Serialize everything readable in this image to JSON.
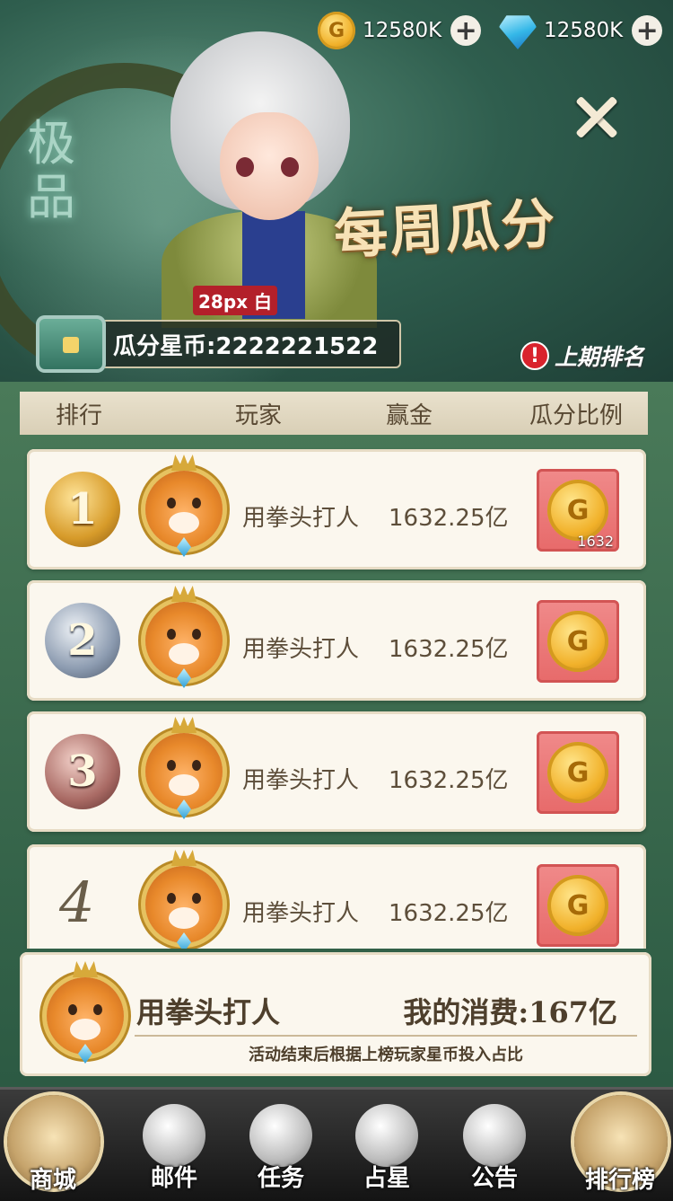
{
  "header": {
    "currencies": [
      {
        "icon": "gold-coin-icon",
        "value": "12580K"
      },
      {
        "icon": "diamond-gem-icon",
        "value": "12580K"
      }
    ],
    "banner_title": "每周瓜分",
    "calligraphy": "极品",
    "size_tip": "28px 白",
    "pool_label": "瓜分星币:2222221522",
    "last_rank_mark": "!",
    "last_rank_label": "上期排名"
  },
  "table": {
    "columns": [
      "排行",
      "玩家",
      "赢金",
      "瓜分比例"
    ],
    "rows": [
      {
        "rank": "1",
        "medal": "gold",
        "name": "用拳头打人",
        "winnings": "1632.25亿",
        "reward_count": "1632"
      },
      {
        "rank": "2",
        "medal": "silver",
        "name": "用拳头打人",
        "winnings": "1632.25亿",
        "reward_count": ""
      },
      {
        "rank": "3",
        "medal": "bronze",
        "name": "用拳头打人",
        "winnings": "1632.25亿",
        "reward_count": ""
      },
      {
        "rank": "4",
        "medal": "",
        "name": "用拳头打人",
        "winnings": "1632.25亿",
        "reward_count": ""
      }
    ]
  },
  "me": {
    "name": "用拳头打人",
    "spend": "我的消费:167亿",
    "note": "活动结束后根据上榜玩家星币投入占比"
  },
  "nav": [
    {
      "label": "商城",
      "icon": "shop-icon"
    },
    {
      "label": "邮件",
      "icon": "mail-icon"
    },
    {
      "label": "任务",
      "icon": "task-icon"
    },
    {
      "label": "占星",
      "icon": "astrology-icon"
    },
    {
      "label": "公告",
      "icon": "announcement-icon"
    },
    {
      "label": "排行榜",
      "icon": "leaderboard-icon"
    }
  ],
  "colors": {
    "accent": "#2f5a44",
    "reward_bg": "#e76a6a",
    "card_bg": "#fbf7ee"
  }
}
